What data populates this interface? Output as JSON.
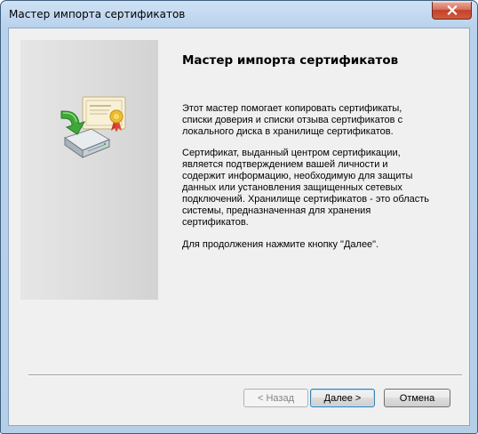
{
  "window": {
    "title": "Мастер импорта сертификатов"
  },
  "controls": {
    "close_icon": "close-icon"
  },
  "content": {
    "heading": "Мастер импорта сертификатов",
    "paragraph1": "Этот мастер помогает копировать сертификаты, списки доверия и списки отзыва сертификатов с локального диска в хранилище сертификатов.",
    "paragraph2": "Сертификат, выданный центром сертификации, является подтверждением вашей личности и содержит информацию, необходимую для защиты данных или установления защищенных сетевых подключений. Хранилище сертификатов - это область системы, предназначенная для хранения сертификатов.",
    "paragraph3": "Для продолжения нажмите кнопку \"Далее\"."
  },
  "buttons": {
    "back_label": "< Назад",
    "next_label": "Далее >",
    "cancel_label": "Отмена"
  },
  "icons": {
    "wizard_icon": "certificate-import-icon"
  },
  "colors": {
    "titlebar": "#b9d2ec",
    "close_button": "#c2422a",
    "dialog_background": "#f0f0f0",
    "default_button_border": "#3c7fb1"
  }
}
